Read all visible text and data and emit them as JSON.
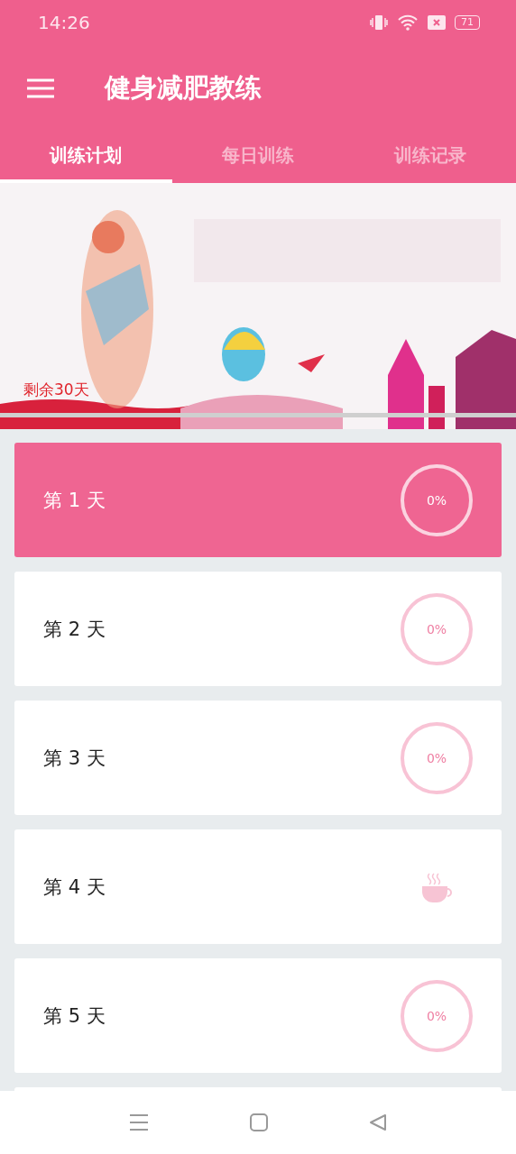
{
  "status_bar": {
    "time": "14:26",
    "battery": "71"
  },
  "app_bar": {
    "title": "健身减肥教练"
  },
  "tabs": [
    {
      "label": "训练计划",
      "selected": true
    },
    {
      "label": "每日训练",
      "selected": false
    },
    {
      "label": "训练记录",
      "selected": false
    }
  ],
  "banner": {
    "kind": "picture",
    "caption": "剩余30天"
  },
  "days": [
    {
      "label": "第 1 天",
      "kind": "progress",
      "selected": true,
      "progress": "0%",
      "level": 0
    },
    {
      "label": "第 2 天",
      "kind": "progress",
      "selected": false,
      "progress": "0%",
      "level": 0
    },
    {
      "label": "第 3 天",
      "kind": "progress",
      "selected": false,
      "progress": "0%",
      "level": 0
    },
    {
      "label": "第 4 天",
      "kind": "rest",
      "selected": false
    },
    {
      "label": "第 5 天",
      "kind": "progress",
      "selected": false,
      "progress": "0%",
      "level": 0
    }
  ]
}
